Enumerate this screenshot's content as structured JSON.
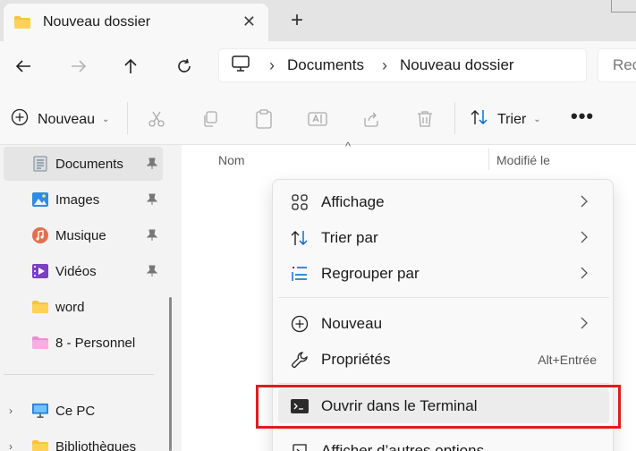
{
  "tab": {
    "title": "Nouveau dossier",
    "close": "✕",
    "new_tab": "+"
  },
  "nav": {
    "back": "back-arrow-icon",
    "forward": "forward-arrow-icon",
    "up": "up-arrow-icon",
    "refresh": "refresh-icon",
    "breadcrumb": [
      "Documents",
      "Nouveau dossier"
    ],
    "search_placeholder": "Rec"
  },
  "commandbar": {
    "new_label": "Nouveau",
    "sort_label": "Trier",
    "tools": [
      "cut-icon",
      "copy-icon",
      "paste-icon",
      "rename-icon",
      "share-icon",
      "delete-icon"
    ],
    "more": "•••"
  },
  "sidebar": {
    "items": [
      {
        "label": "Documents",
        "icon": "documents-icon",
        "pinned": true,
        "selected": true
      },
      {
        "label": "Images",
        "icon": "images-icon",
        "pinned": true
      },
      {
        "label": "Musique",
        "icon": "music-icon",
        "pinned": true
      },
      {
        "label": "Vidéos",
        "icon": "videos-icon",
        "pinned": true
      },
      {
        "label": "word",
        "icon": "folder-icon"
      },
      {
        "label": "8 - Personnel",
        "icon": "folder-pink-icon"
      }
    ],
    "tree": [
      {
        "label": "Ce PC",
        "icon": "pc-icon"
      },
      {
        "label": "Bibliothèques",
        "icon": "library-icon"
      }
    ]
  },
  "content": {
    "columns": {
      "name": "Nom",
      "date": "Modifié le"
    }
  },
  "context_menu": {
    "items": [
      {
        "label": "Affichage",
        "icon": "view-grid-icon",
        "submenu": true
      },
      {
        "label": "Trier par",
        "icon": "sort-icon",
        "submenu": true
      },
      {
        "label": "Regrouper par",
        "icon": "group-icon",
        "submenu": true
      },
      {
        "label": "Nouveau",
        "icon": "new-plus-icon",
        "submenu": true
      },
      {
        "label": "Propriétés",
        "icon": "wrench-icon",
        "accelerator": "Alt+Entrée"
      },
      {
        "label": "Ouvrir dans le Terminal",
        "icon": "terminal-icon",
        "highlighted": true
      },
      {
        "label": "Afficher d’autres options",
        "icon": "more-options-icon"
      }
    ]
  },
  "colors": {
    "highlight_box": "#e01b24",
    "folder": "#f4c542",
    "accent": "#0067c0"
  }
}
